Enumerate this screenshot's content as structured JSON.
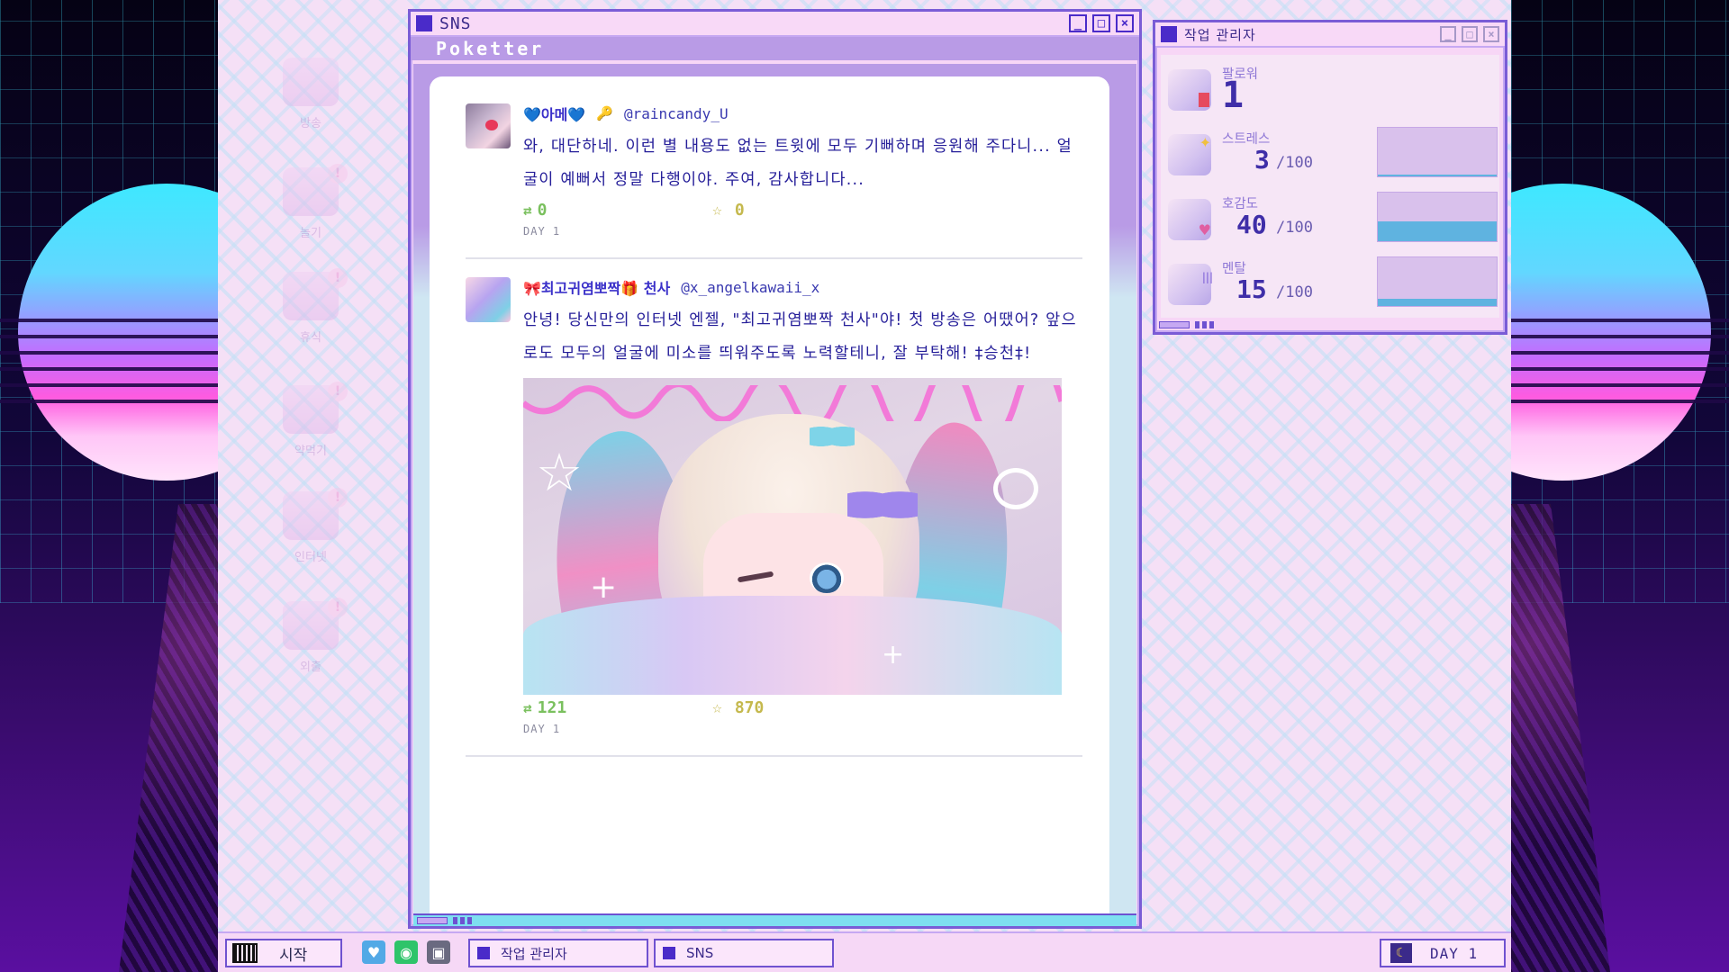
{
  "desktop_icons": [
    {
      "label": "방송",
      "icon": "stream-icon",
      "badge": ""
    },
    {
      "label": "놀기",
      "icon": "play-icon",
      "badge": "!"
    },
    {
      "label": "휴식",
      "icon": "rest-icon",
      "badge": "!"
    },
    {
      "label": "약먹기",
      "icon": "medicine-icon",
      "badge": "!"
    },
    {
      "label": "인터넷",
      "icon": "internet-icon",
      "badge": "!"
    },
    {
      "label": "외출",
      "icon": "outing-icon",
      "badge": "!"
    }
  ],
  "sns_window": {
    "title": "SNS",
    "app_name": "Poketter",
    "controls": [
      "_",
      "□",
      "×"
    ],
    "posts": [
      {
        "display_name": "💙아메💙",
        "key_icon": "🔑",
        "handle": "@raincandy_U",
        "text": "와, 대단하네. 이런 별 내용도 없는 트윗에 모두 기뻐하며 응원해 주다니... 얼굴이 예뻐서 정말 다행이야. 주여, 감사합니다...",
        "retweet_icon": "⇄",
        "retweets": "0",
        "fav_icon": "☆",
        "favorites": "0",
        "day": "DAY 1"
      },
      {
        "display_name": "🎀최고귀염뽀짝🎁 천사",
        "handle": "@x_angelkawaii_x",
        "text": "안녕! 당신만의 인터넷 엔젤, \"최고귀염뽀짝 천사\"야! 첫 방송은 어땠어? 앞으로도 모두의 얼굴에 미소를 띄워주도록 노력할테니, 잘 부탁해! ‡승천‡!",
        "retweet_icon": "⇄",
        "retweets": "121",
        "fav_icon": "☆",
        "favorites": "870",
        "day": "DAY 1"
      }
    ]
  },
  "task_manager": {
    "title": "작업 관리자",
    "stats": {
      "followers": {
        "label": "팔로워",
        "value": "1"
      },
      "stress": {
        "label": "스트레스",
        "value": "3",
        "max": "/100",
        "level": 0.03
      },
      "affection": {
        "label": "호감도",
        "value": "40",
        "max": "/100",
        "level": 0.4
      },
      "mental": {
        "label": "멘탈",
        "value": "15",
        "max": "/100",
        "level": 0.15
      }
    }
  },
  "taskbar": {
    "start_label": "시작",
    "quick_icons": [
      "twitter-icon",
      "messenger-icon",
      "computer-icon"
    ],
    "tasks": [
      {
        "label": "작업 관리자"
      },
      {
        "label": "SNS"
      }
    ],
    "day_label": "DAY 1"
  },
  "colors": {
    "accent": "#4a2bc9",
    "window_bg": "#f7d6f6",
    "text_primary": "#27209a",
    "retweet": "#7ac05e",
    "favorite": "#c5b94e",
    "bar_fill": "#5fb3e0"
  }
}
